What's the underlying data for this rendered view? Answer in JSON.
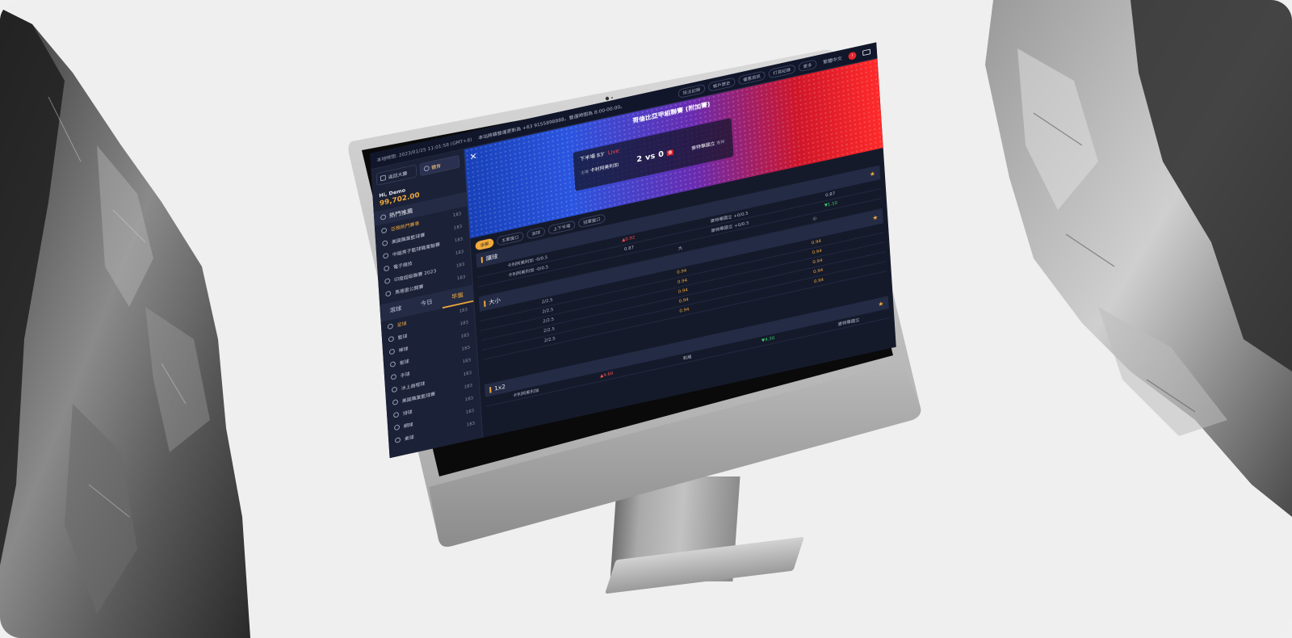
{
  "topbar": {
    "time": "本地時間: 2023/01/25 11:01:58 (GMT+8)",
    "notice": "本站將鑄營運更新為 +63 9155898888，營運時間為 8:00-00:00。",
    "buttons": [
      "投注記錄",
      "帳戶歷史",
      "優惠資訊",
      "打賞紀錄",
      "更多"
    ],
    "language": "繁體中文",
    "odds_format": "賠率：香港盤"
  },
  "sidebar": {
    "lobby_label": "返回大廳",
    "sport_tab_label": "體育",
    "user_name": "Hi, Demo",
    "balance": "99,702.00",
    "hot_section_title": "熱門推薦",
    "hot_items": [
      {
        "label": "亞預熱門賽事",
        "count": "183"
      },
      {
        "label": "美國職業籃球賽",
        "count": "183"
      },
      {
        "label": "中國男子籃球職業聯賽",
        "count": "183"
      },
      {
        "label": "電子競技",
        "count": "183"
      },
      {
        "label": "印度超級聯賽 2023",
        "count": "183"
      },
      {
        "label": "馬德里公開賽",
        "count": "183"
      }
    ],
    "sport_tabs": [
      "滾球",
      "今日",
      "早盤"
    ],
    "sports": [
      {
        "label": "足球",
        "count": "183"
      },
      {
        "label": "籃球",
        "count": "183"
      },
      {
        "label": "棒球",
        "count": "183"
      },
      {
        "label": "板球",
        "count": "183"
      },
      {
        "label": "手球",
        "count": "183"
      },
      {
        "label": "冰上曲棍球",
        "count": "183"
      },
      {
        "label": "美國職業籃球賽",
        "count": "183"
      },
      {
        "label": "排球",
        "count": "183"
      },
      {
        "label": "網球",
        "count": "183"
      },
      {
        "label": "桌球",
        "count": "183"
      }
    ]
  },
  "match": {
    "league": "哥倫比亞甲組聯賽 (附加賽)",
    "period": "下半場 83'",
    "live_label": "Live",
    "home_badge": "主場",
    "home_team": "卡利阿美利加",
    "home_score": "2",
    "vs": "vs",
    "away_score": "0",
    "away_red_cards": "0",
    "away_team": "麥特華國立",
    "away_badge": "客隊"
  },
  "filters": [
    "全部",
    "主要盤口",
    "滾球",
    "上下半場",
    "冠軍盤口"
  ],
  "markets": {
    "handicap": {
      "title": "讓球",
      "rows": [
        {
          "a": "卡利阿美利加 -0/0.5",
          "b": "▲0.92",
          "c": "麥特華國立 +0/0.5",
          "d": "0.87"
        },
        {
          "a": "卡利阿美利加 -0/0.5",
          "b": "0.87",
          "c": "麥特華國立 +0/0.5",
          "d": "▼1.10"
        }
      ]
    },
    "over_under": {
      "title": "大小",
      "header": [
        "",
        "大",
        "小"
      ],
      "rows": [
        {
          "a": "2/2.5",
          "b": "0.94",
          "c": "0.94"
        },
        {
          "a": "2/2.5",
          "b": "0.94",
          "c": "0.94"
        },
        {
          "a": "2/2.5",
          "b": "0.94",
          "c": "0.94"
        },
        {
          "a": "2/2.5",
          "b": "0.94",
          "c": "0.94"
        },
        {
          "a": "2/2.5",
          "b": "0.94",
          "c": "0.94"
        }
      ]
    },
    "one_x_two": {
      "title": "1x2",
      "rows": [
        {
          "a": "卡利阿美利加",
          "b": "▲4.60",
          "c": "和局",
          "d": "▼4.30",
          "e": "麥特華國立"
        }
      ]
    }
  },
  "colors": {
    "accent": "#f0a93b",
    "background": "#151a2b",
    "live": "#ff4d4d",
    "odds_up": "#ff4d4d",
    "odds_down": "#3ad06a"
  }
}
